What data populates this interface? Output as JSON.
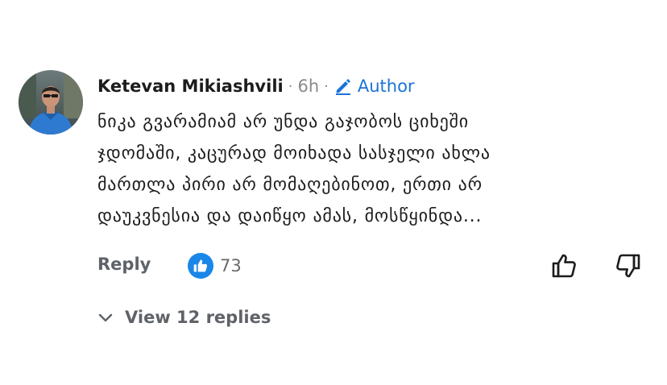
{
  "comment": {
    "author": "Ketevan Mikiashvili",
    "separator": "·",
    "time": "6h",
    "badge": "Author",
    "lines": [
      "ნიკა გვარამიამ არ უნდა გაჯობოს ციხეში",
      "ჯდომაში, კაცურად მოიხადა სასჯელი ახლა",
      "მართლა პირი არ მომაღებინოთ, ერთი არ",
      "დაუკვნესია და დაიწყო ამას, მოსწყინდა..."
    ],
    "avatar_icon": "profile-photo",
    "pencil_icon": "pencil-icon"
  },
  "actions": {
    "reply_label": "Reply",
    "like_count": "73",
    "like_badge_icon": "thumbs-up-icon",
    "upvote_icon": "thumbs-up-outline-icon",
    "downvote_icon": "thumbs-down-outline-icon"
  },
  "replies": {
    "label": "View 12 replies",
    "icon": "chevron-down-icon"
  },
  "colors": {
    "accent": "#1a73d9",
    "like_badge": "#1a86e8",
    "muted": "#5f6368",
    "text": "#1c1c1c"
  }
}
